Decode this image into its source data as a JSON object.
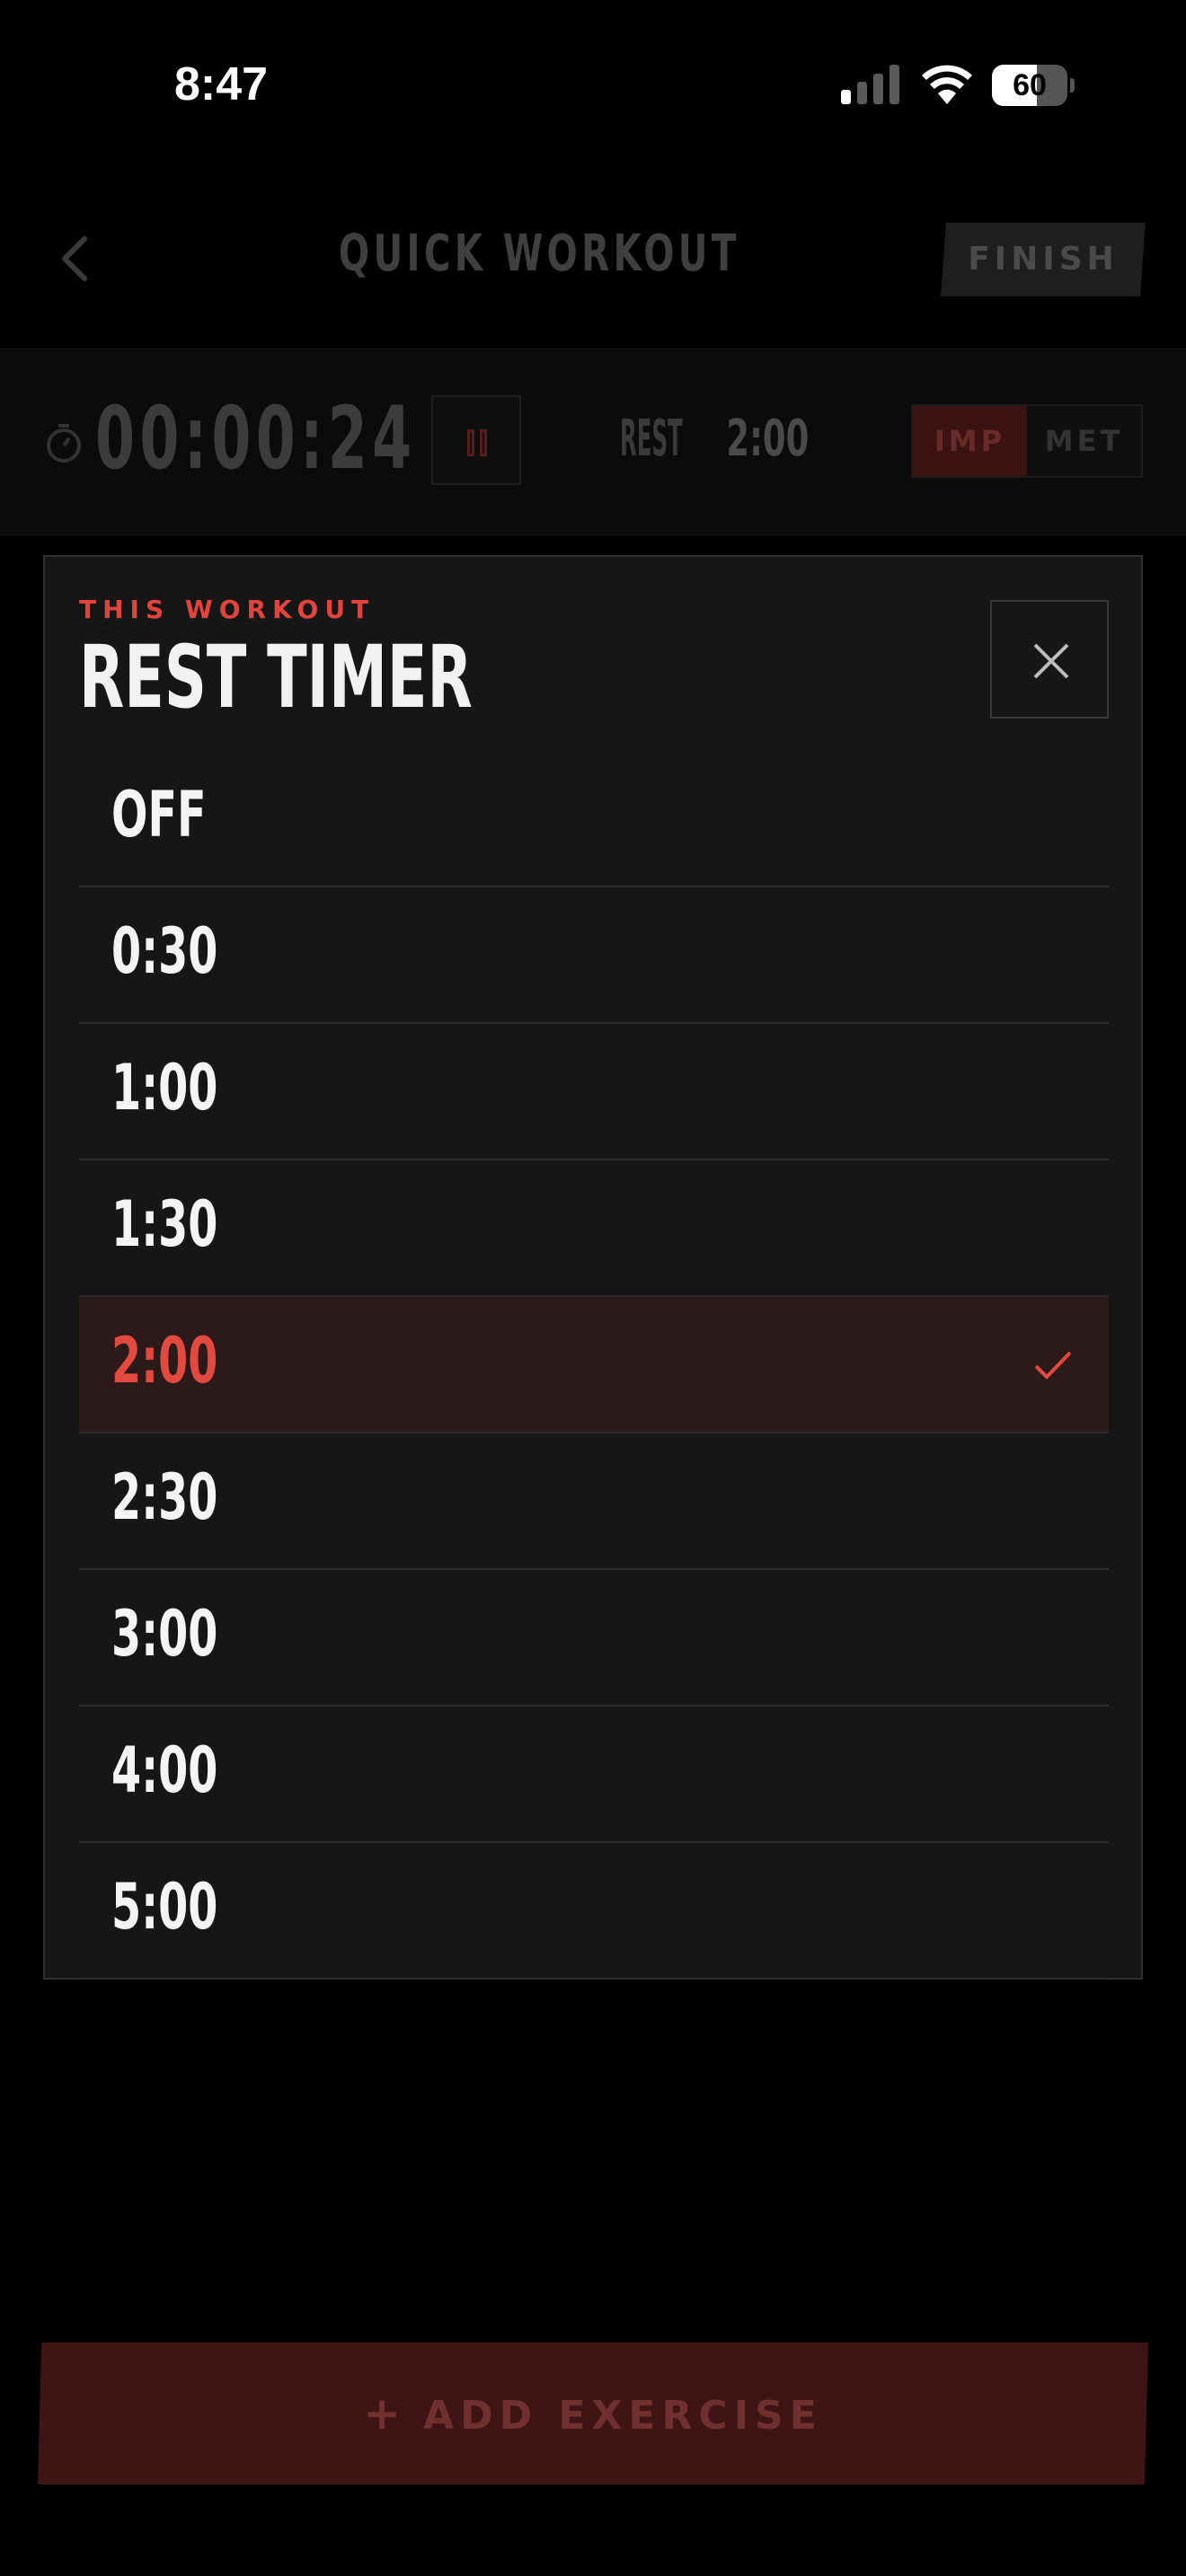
{
  "status_bar": {
    "time": "8:47",
    "battery_level": "60",
    "battery_fraction": 0.6
  },
  "header": {
    "title": "QUICK WORKOUT",
    "finish_label": "FINISH"
  },
  "timer_bar": {
    "elapsed": "00:00:24",
    "rest_label": "REST",
    "rest_value": "2:00",
    "units": [
      "IMP",
      "MET"
    ],
    "active_unit": "IMP"
  },
  "modal": {
    "eyebrow": "THIS WORKOUT",
    "title": "REST TIMER",
    "options": [
      {
        "label": "OFF",
        "selected": false
      },
      {
        "label": "0:30",
        "selected": false
      },
      {
        "label": "1:00",
        "selected": false
      },
      {
        "label": "1:30",
        "selected": false
      },
      {
        "label": "2:00",
        "selected": true
      },
      {
        "label": "2:30",
        "selected": false
      },
      {
        "label": "3:00",
        "selected": false
      },
      {
        "label": "4:00",
        "selected": false
      },
      {
        "label": "5:00",
        "selected": false
      }
    ]
  },
  "footer": {
    "add_exercise_label": "ADD EXERCISE"
  },
  "colors": {
    "accent": "#e24a40",
    "selected_row": "#2c1a1a",
    "modal_bg": "#161616",
    "button_dim": "#3e1414"
  }
}
